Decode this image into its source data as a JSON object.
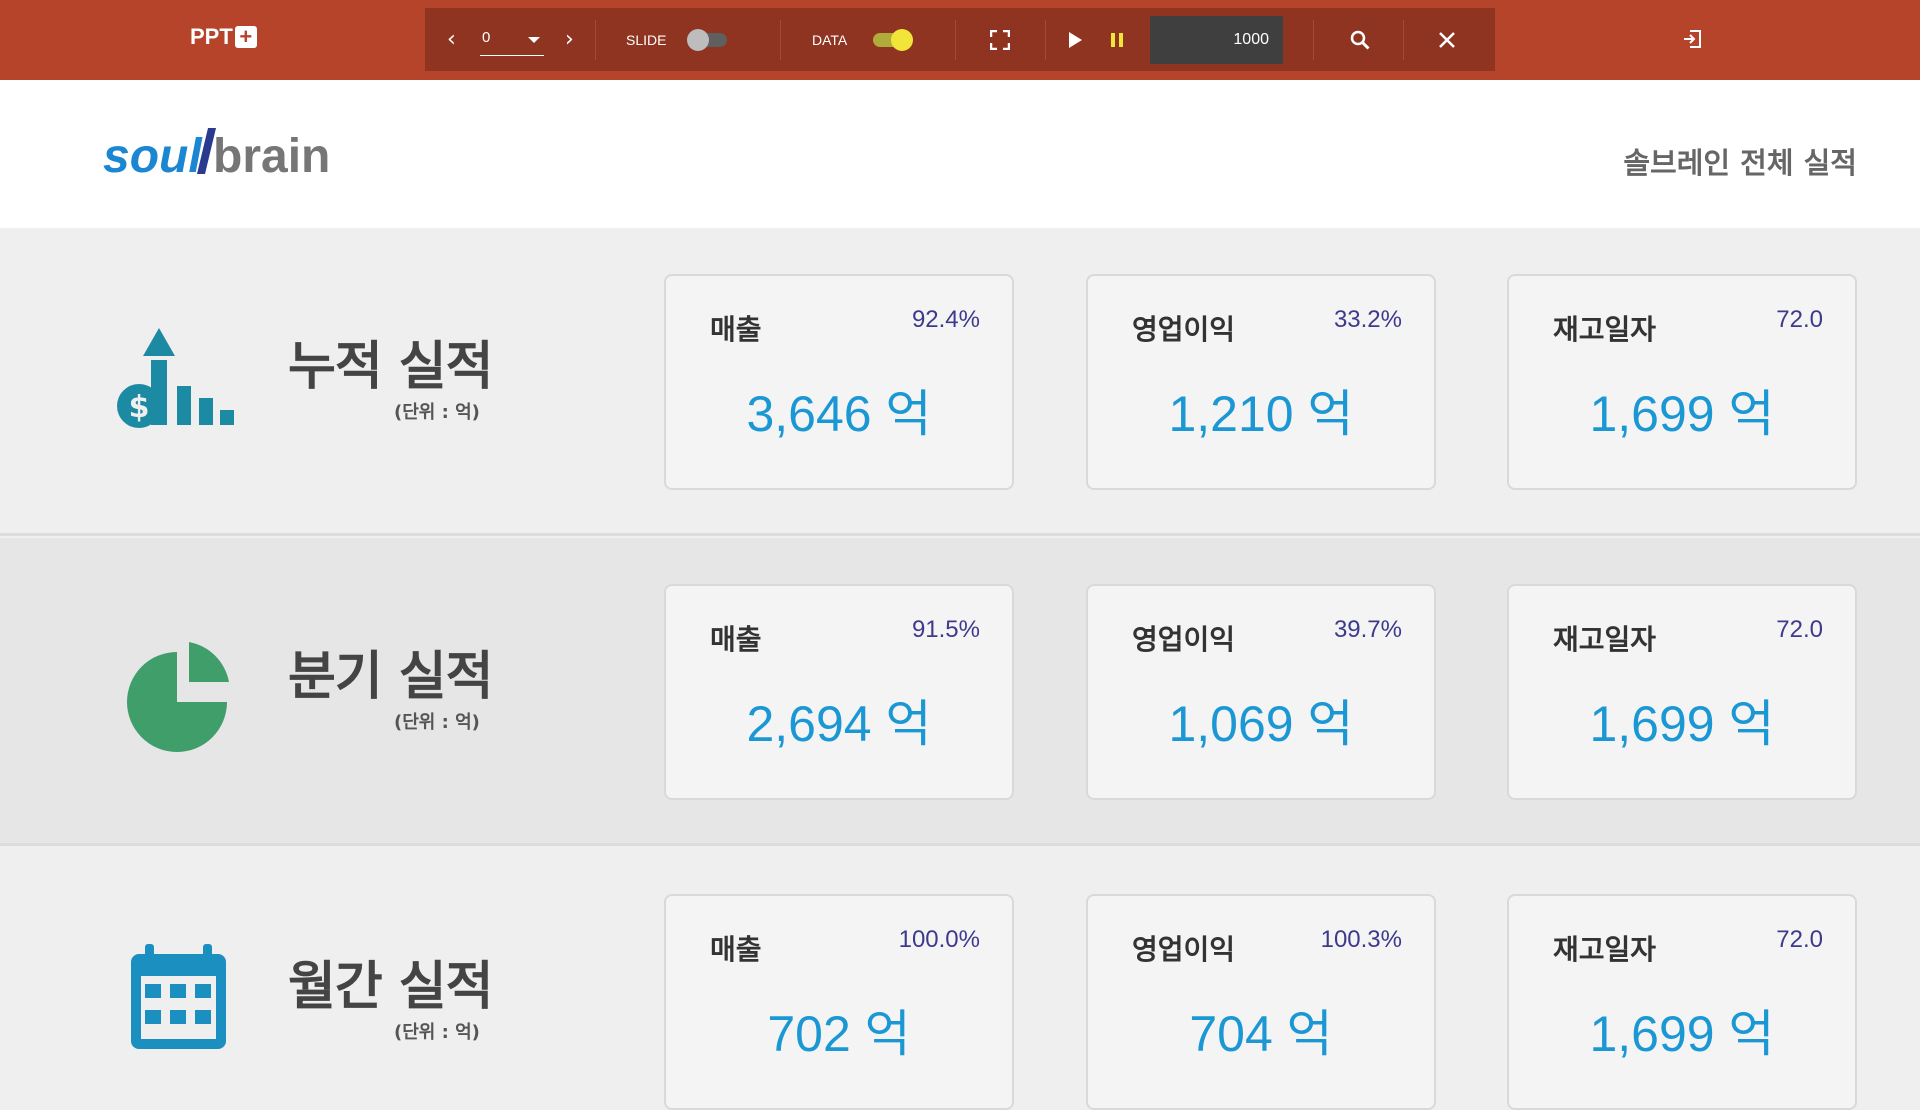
{
  "app": {
    "brand": "PPT",
    "brand_plus": "+"
  },
  "toolbar": {
    "page_value": "0",
    "slide_label": "SLIDE",
    "slide_on": false,
    "data_label": "DATA",
    "data_on": true,
    "interval_value": "1000"
  },
  "header": {
    "logo_soul": "soul",
    "logo_brain": "brain",
    "title": "솔브레인 전체 실적"
  },
  "colors": {
    "topbar": "#b5442a",
    "toolbar": "#8e3421",
    "value": "#1b98d4",
    "percent": "#3d3a8c",
    "icon_teal": "#1d8aa3",
    "icon_green": "#3f9e6a",
    "icon_blue": "#1a8fc0",
    "toggle_on": "#f2e53a"
  },
  "sections": [
    {
      "title": "누적 실적",
      "unit": "(단위 : 억)",
      "icon": "money-growth-chart-icon",
      "cards": [
        {
          "name": "매출",
          "percent": "92.4%",
          "value": "3,646 억"
        },
        {
          "name": "영업이익",
          "percent": "33.2%",
          "value": "1,210 억"
        },
        {
          "name": "재고일자",
          "percent": "72.0",
          "value": "1,699 억"
        }
      ]
    },
    {
      "title": "분기 실적",
      "unit": "(단위 : 억)",
      "icon": "pie-chart-icon",
      "cards": [
        {
          "name": "매출",
          "percent": "91.5%",
          "value": "2,694 억"
        },
        {
          "name": "영업이익",
          "percent": "39.7%",
          "value": "1,069 억"
        },
        {
          "name": "재고일자",
          "percent": "72.0",
          "value": "1,699 억"
        }
      ]
    },
    {
      "title": "월간 실적",
      "unit": "(단위 : 억)",
      "icon": "calendar-icon",
      "cards": [
        {
          "name": "매출",
          "percent": "100.0%",
          "value": "702 억"
        },
        {
          "name": "영업이익",
          "percent": "100.3%",
          "value": "704 억"
        },
        {
          "name": "재고일자",
          "percent": "72.0",
          "value": "1,699 억"
        }
      ]
    }
  ]
}
